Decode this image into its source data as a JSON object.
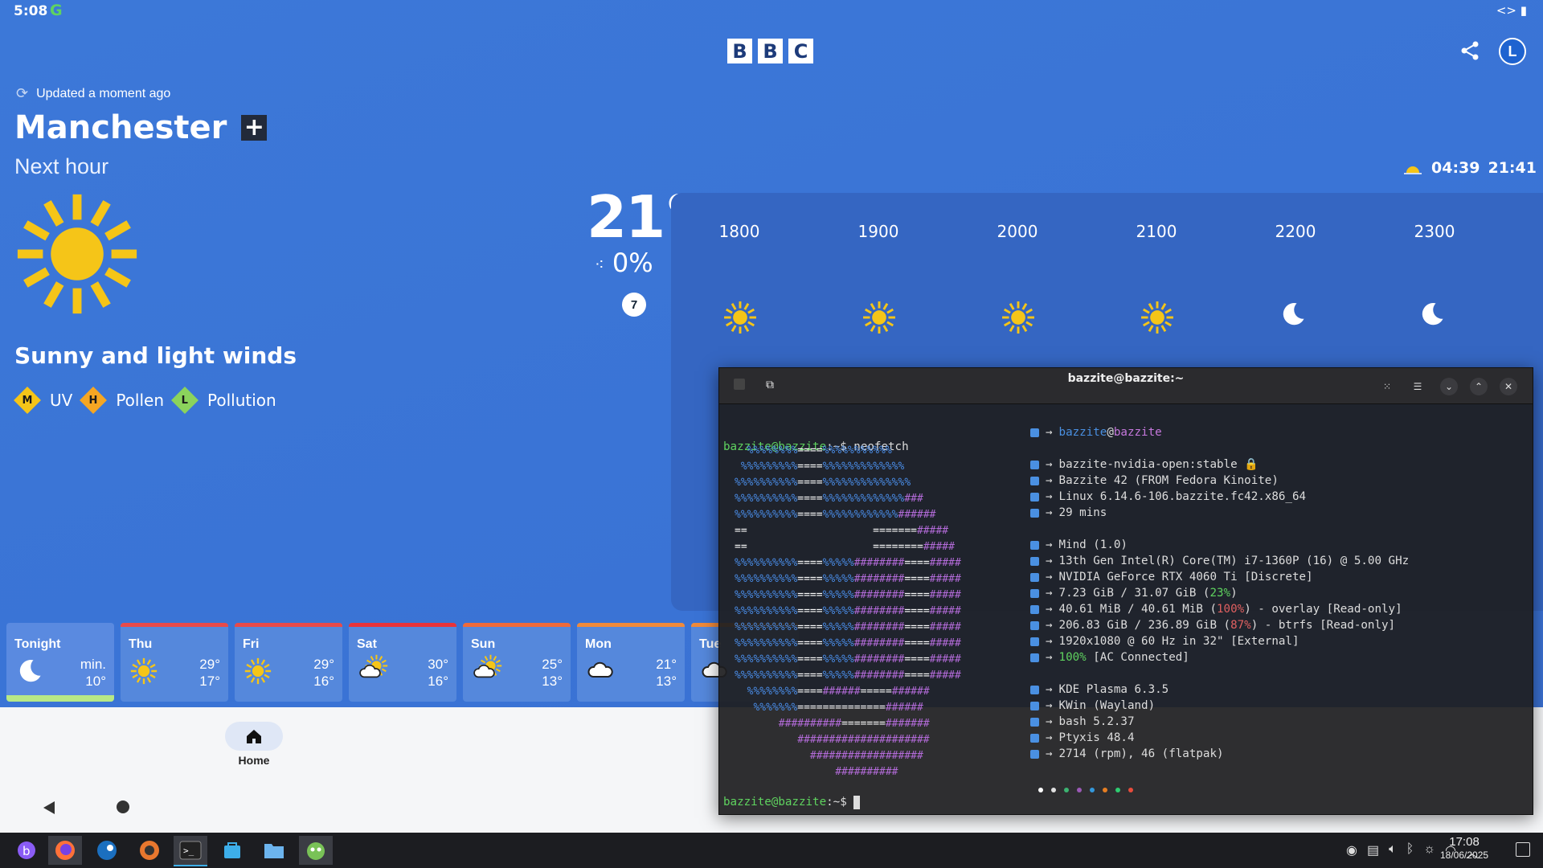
{
  "statusbar": {
    "time": "5:08",
    "g": "G",
    "right": "<> ▮"
  },
  "header": {
    "logo": [
      "B",
      "B",
      "C"
    ],
    "avatar": "L"
  },
  "location": {
    "updated": "Updated a moment ago",
    "city": "Manchester",
    "add": "+",
    "period": "Next hour",
    "sunrise": "04:39",
    "sunset": "21:41"
  },
  "current": {
    "temp": "21°",
    "rain": "0%",
    "wind": "7",
    "summary": "Sunny and light winds"
  },
  "badges": [
    {
      "level": "M",
      "label": "UV",
      "color": "#f5c518"
    },
    {
      "level": "H",
      "label": "Pollen",
      "color": "#f5a623"
    },
    {
      "level": "L",
      "label": "Pollution",
      "color": "#8bd35c"
    }
  ],
  "hours": [
    {
      "time": "1800",
      "icon": "sun-icon"
    },
    {
      "time": "1900",
      "icon": "sun-icon"
    },
    {
      "time": "2000",
      "icon": "sun-icon"
    },
    {
      "time": "2100",
      "icon": "sun-icon"
    },
    {
      "time": "2200",
      "icon": "moon-icon"
    },
    {
      "time": "2300",
      "icon": "moon-icon"
    }
  ],
  "days": [
    {
      "name": "Tonight",
      "hi": "min.",
      "lo": "10°",
      "icon": "moon-icon"
    },
    {
      "name": "Thu",
      "hi": "29°",
      "lo": "17°",
      "icon": "sun-icon",
      "bar": "#e84a4a"
    },
    {
      "name": "Fri",
      "hi": "29°",
      "lo": "16°",
      "icon": "sun-icon",
      "bar": "#e84a4a"
    },
    {
      "name": "Sat",
      "hi": "30°",
      "lo": "16°",
      "icon": "thunder-icon",
      "bar": "#e8333a"
    },
    {
      "name": "Sun",
      "hi": "25°",
      "lo": "13°",
      "icon": "cloud-sun-icon",
      "bar": "#ef6a3a"
    },
    {
      "name": "Mon",
      "hi": "21°",
      "lo": "13°",
      "icon": "rain-cloud-icon",
      "bar": "#f08a3a"
    },
    {
      "name": "Tue",
      "hi": "",
      "lo": "",
      "icon": "rain-cloud-icon",
      "bar": "#f08a3a"
    }
  ],
  "nav": {
    "home": "Home"
  },
  "terminal": {
    "title": "bazzite@bazzite:~",
    "prompt": "bazzite@bazzite",
    "path": ":~$ ",
    "cmd": "neofetch",
    "user": "bazzite",
    "at": "@",
    "host": "bazzite",
    "image": "bazzite-nvidia-open:stable 🔒",
    "os": "Bazzite 42 (FROM Fedora Kinoite)",
    "kernel": "Linux 6.14.6-106.bazzite.fc42.x86_64",
    "uptime": "29 mins",
    "board": "Mind (1.0)",
    "cpu": "13th Gen Intel(R) Core(TM) i7-1360P (16) @ 5.00 GHz",
    "gpu": "NVIDIA GeForce RTX 4060 Ti [Discrete]",
    "mem_a": "7.23 GiB / 31.07 GiB (",
    "mem_p": "23%",
    "mem_b": ")",
    "sw_a": "40.61 MiB / 40.61 MiB (",
    "sw_p": "100%",
    "sw_b": ") - overlay [Read-only]",
    "disk_a": "206.83 GiB / 236.89 GiB (",
    "disk_p": "87%",
    "disk_b": ") - btrfs [Read-only]",
    "display": "1920x1080 @ 60 Hz in 32\" [External]",
    "bat_p": "100%",
    "bat_b": " [AC Connected]",
    "de": "KDE Plasma 6.3.5",
    "wm": "KWin (Wayland)",
    "shell": "bash 5.2.37",
    "term": "Ptyxis 48.4",
    "pkgs": "2714 (rpm), 46 (flatpak)",
    "arrow": "→"
  },
  "taskbar": {
    "time": "17:08",
    "date": "18/06/2025"
  }
}
